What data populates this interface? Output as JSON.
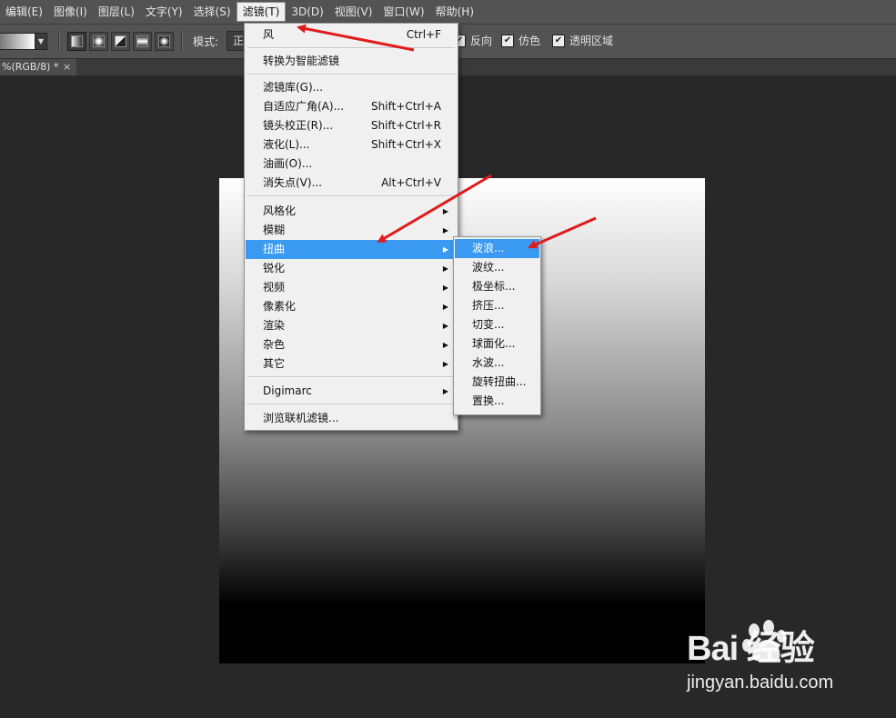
{
  "menubar": {
    "items": [
      {
        "label": "编辑(E)"
      },
      {
        "label": "图像(I)"
      },
      {
        "label": "图层(L)"
      },
      {
        "label": "文字(Y)"
      },
      {
        "label": "选择(S)"
      },
      {
        "label": "滤镜(T)",
        "active": true
      },
      {
        "label": "3D(D)"
      },
      {
        "label": "视图(V)"
      },
      {
        "label": "窗口(W)"
      },
      {
        "label": "帮助(H)"
      }
    ]
  },
  "options_bar": {
    "mode_label": "模式:",
    "mode_value": "正",
    "checkboxes": [
      {
        "label": "反向",
        "checked": true
      },
      {
        "label": "仿色",
        "checked": true
      },
      {
        "label": "透明区域",
        "checked": true
      }
    ]
  },
  "document_tab": {
    "title": "%(RGB/8) *",
    "close": "×"
  },
  "filter_menu": {
    "items": [
      {
        "label": "风",
        "shortcut": "Ctrl+F"
      },
      {
        "label": "转换为智能滤镜"
      },
      {
        "label": "滤镜库(G)..."
      },
      {
        "label": "自适应广角(A)...",
        "shortcut": "Shift+Ctrl+A"
      },
      {
        "label": "镜头校正(R)...",
        "shortcut": "Shift+Ctrl+R"
      },
      {
        "label": "液化(L)...",
        "shortcut": "Shift+Ctrl+X"
      },
      {
        "label": "油画(O)..."
      },
      {
        "label": "消失点(V)...",
        "shortcut": "Alt+Ctrl+V"
      },
      {
        "label": "风格化",
        "submenu": true
      },
      {
        "label": "模糊",
        "submenu": true
      },
      {
        "label": "扭曲",
        "submenu": true,
        "highlighted": true
      },
      {
        "label": "锐化",
        "submenu": true
      },
      {
        "label": "视频",
        "submenu": true
      },
      {
        "label": "像素化",
        "submenu": true
      },
      {
        "label": "渲染",
        "submenu": true
      },
      {
        "label": "杂色",
        "submenu": true
      },
      {
        "label": "其它",
        "submenu": true
      },
      {
        "label": "Digimarc",
        "submenu": true
      },
      {
        "label": "浏览联机滤镜..."
      }
    ]
  },
  "distort_submenu": {
    "items": [
      {
        "label": "波浪...",
        "highlighted": true
      },
      {
        "label": "波纹..."
      },
      {
        "label": "极坐标..."
      },
      {
        "label": "挤压..."
      },
      {
        "label": "切变..."
      },
      {
        "label": "球面化..."
      },
      {
        "label": "水波..."
      },
      {
        "label": "旋转扭曲..."
      },
      {
        "label": "置换..."
      }
    ]
  },
  "watermark": {
    "brand": "Bai  经验",
    "url": "jingyan.baidu.com"
  },
  "colors": {
    "highlight": "#3a9af2",
    "annotation_arrow": "#e01b1b"
  },
  "icons": {
    "submenu_arrow": "triangle-right",
    "checkbox": "checkmark",
    "dropdown": "chevron-down"
  }
}
